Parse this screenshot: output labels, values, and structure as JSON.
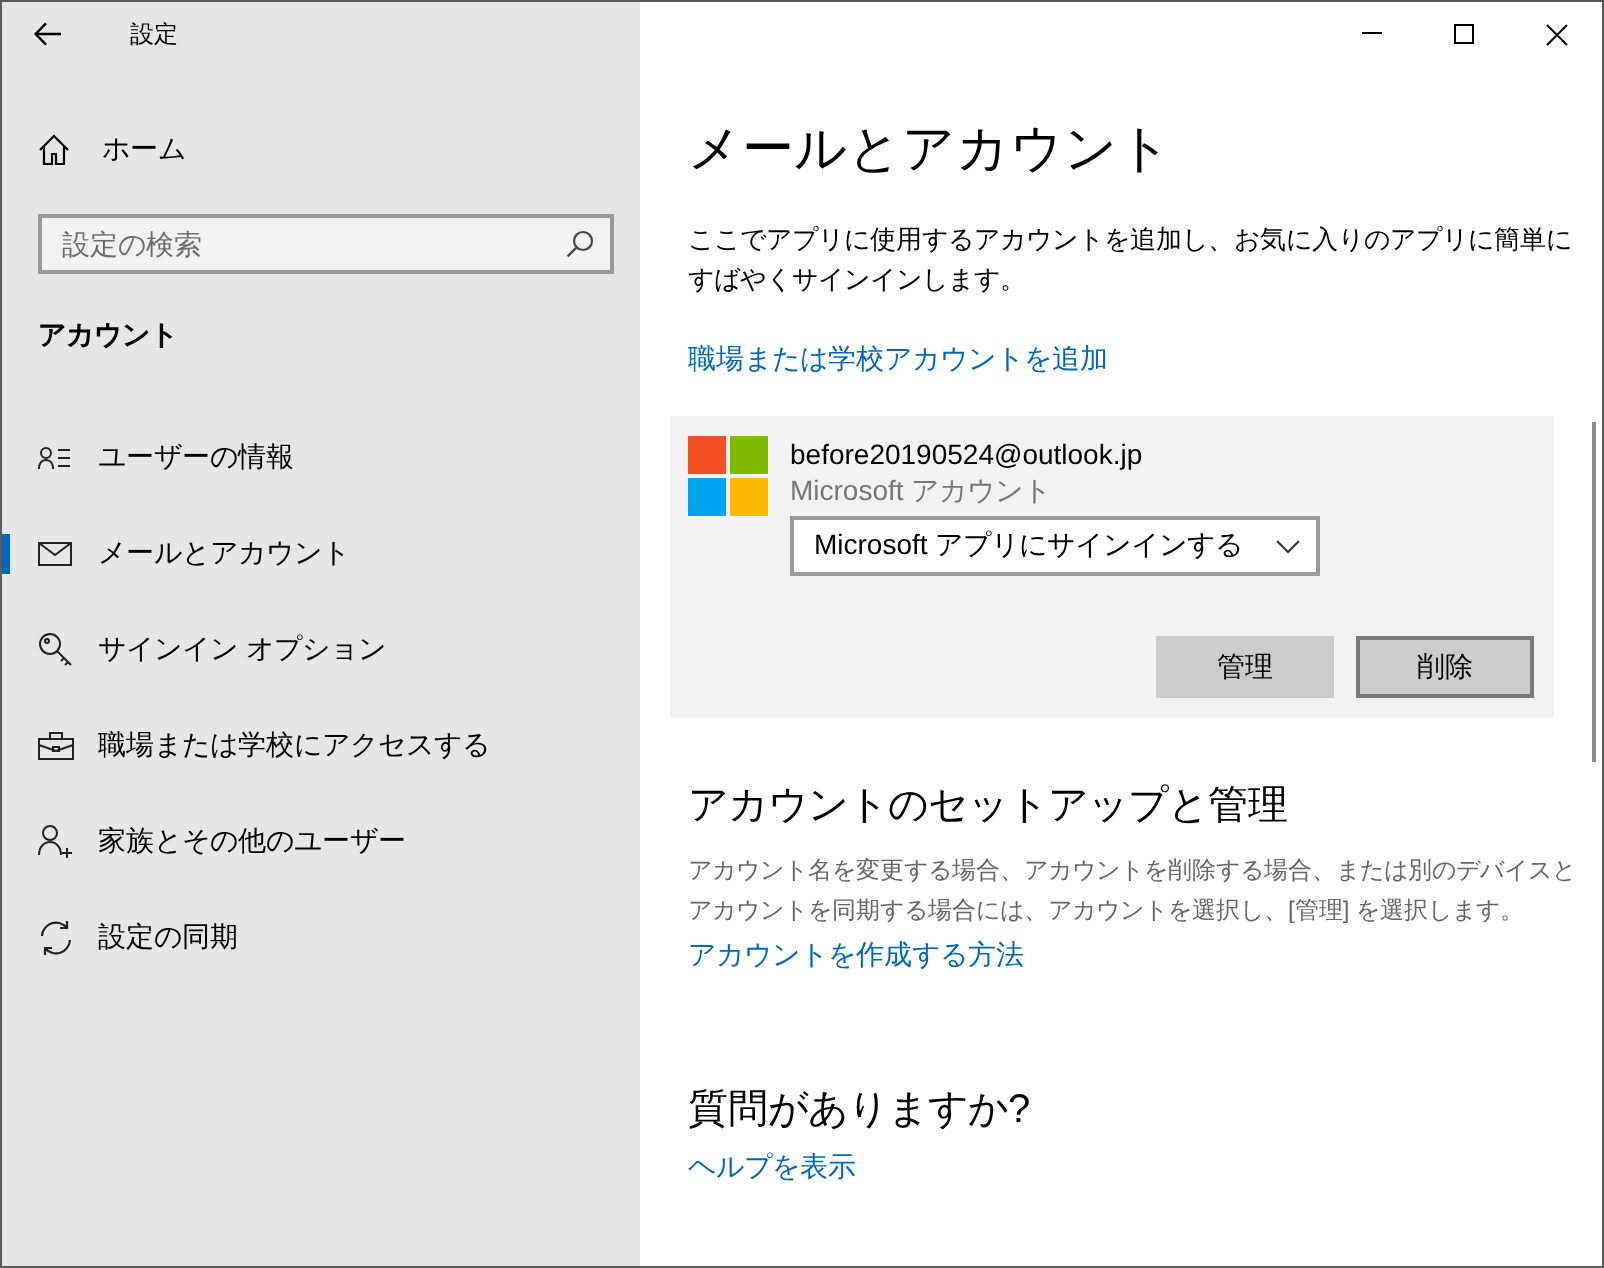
{
  "window": {
    "title": "設定"
  },
  "sidebar": {
    "home": "ホーム",
    "search": {
      "placeholder": "設定の検索"
    },
    "section": "アカウント",
    "items": [
      {
        "label": "ユーザーの情報",
        "selected": false
      },
      {
        "label": "メールとアカウント",
        "selected": true
      },
      {
        "label": "サインイン オプション",
        "selected": false
      },
      {
        "label": "職場または学校にアクセスする",
        "selected": false
      },
      {
        "label": "家族とその他のユーザー",
        "selected": false
      },
      {
        "label": "設定の同期",
        "selected": false
      }
    ]
  },
  "main": {
    "title": "メールとアカウント",
    "description": "ここでアプリに使用するアカウントを追加し、お気に入りのアプリに簡単にすばやくサインインします。",
    "add_link": "職場または学校アカウントを追加",
    "account": {
      "email": "before20190524@outlook.jp",
      "type": "Microsoft アカウント",
      "dropdown": {
        "value": "Microsoft アプリにサインインする"
      },
      "buttons": [
        {
          "label": "管理",
          "focused": false
        },
        {
          "label": "削除",
          "focused": true
        }
      ]
    },
    "sections": [
      {
        "heading": "アカウントのセットアップと管理",
        "text": "アカウント名を変更する場合、アカウントを削除する場合、または別のデバイスとアカウントを同期する場合には、アカウントを選択し、[管理] を選択します。",
        "link": "アカウントを作成する方法"
      },
      {
        "heading": "質問がありますか?",
        "link": "ヘルプを表示"
      }
    ]
  }
}
